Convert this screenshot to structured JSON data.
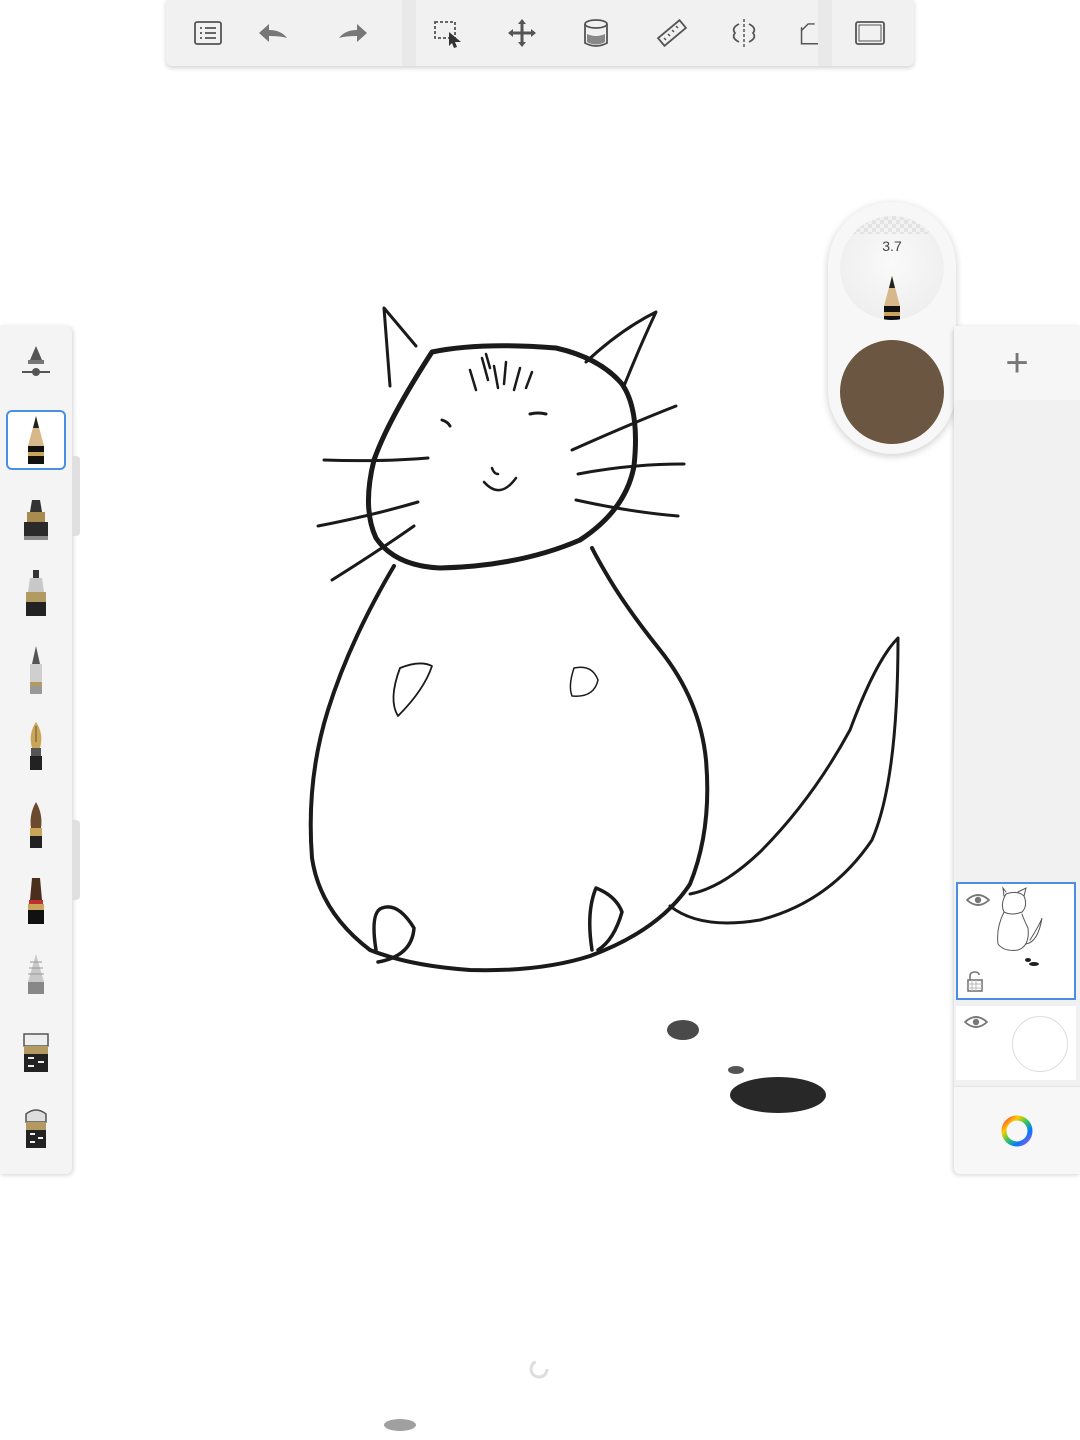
{
  "toolbar": {
    "buttons": [
      {
        "name": "gallery-menu-button",
        "icon": "list-icon"
      },
      {
        "name": "undo-button",
        "icon": "undo-arrow-icon"
      },
      {
        "name": "redo-button",
        "icon": "redo-arrow-icon"
      },
      {
        "name": "selection-button",
        "icon": "marquee-select-icon"
      },
      {
        "name": "transform-button",
        "icon": "move-arrows-icon"
      },
      {
        "name": "fill-button",
        "icon": "paint-bucket-icon"
      },
      {
        "name": "ruler-button",
        "icon": "ruler-icon"
      },
      {
        "name": "symmetry-button",
        "icon": "symmetry-icon"
      },
      {
        "name": "perspective-button",
        "icon": "perspective-icon"
      },
      {
        "name": "fullscreen-button",
        "icon": "fullscreen-icon"
      }
    ]
  },
  "brush_palette": {
    "brushes": [
      {
        "name": "brush-properties-button",
        "icon": "brush-properties-icon"
      },
      {
        "name": "pencil-brush",
        "icon": "pencil-icon",
        "selected": true
      },
      {
        "name": "marker-brush",
        "icon": "marker-icon"
      },
      {
        "name": "ink-pen-brush",
        "icon": "ink-pen-icon"
      },
      {
        "name": "ballpoint-brush",
        "icon": "ballpoint-icon"
      },
      {
        "name": "fountain-pen-brush",
        "icon": "fountain-pen-icon"
      },
      {
        "name": "paint-brush",
        "icon": "paint-brush-icon"
      },
      {
        "name": "flat-brush",
        "icon": "flat-brush-icon"
      },
      {
        "name": "airbrush",
        "icon": "airbrush-icon"
      },
      {
        "name": "hard-eraser",
        "icon": "eraser-icon"
      },
      {
        "name": "soft-eraser",
        "icon": "soft-eraser-icon"
      }
    ]
  },
  "puck": {
    "brush_size": "3.7",
    "current_color": "#6b5642",
    "brush_icon": "pencil-icon"
  },
  "layers": {
    "add_icon": "plus-icon",
    "add_label": "+",
    "items": [
      {
        "name": "layer-1",
        "visible": true,
        "active": true,
        "icon": "eye-icon"
      },
      {
        "name": "background-layer",
        "visible": true,
        "active": false,
        "icon": "eye-icon"
      }
    ],
    "color_button_icon": "color-wheel-icon"
  },
  "colors": {
    "accent": "#4a90e2",
    "stroke": "#1a1a1a",
    "panel": "#f1f1f1"
  }
}
